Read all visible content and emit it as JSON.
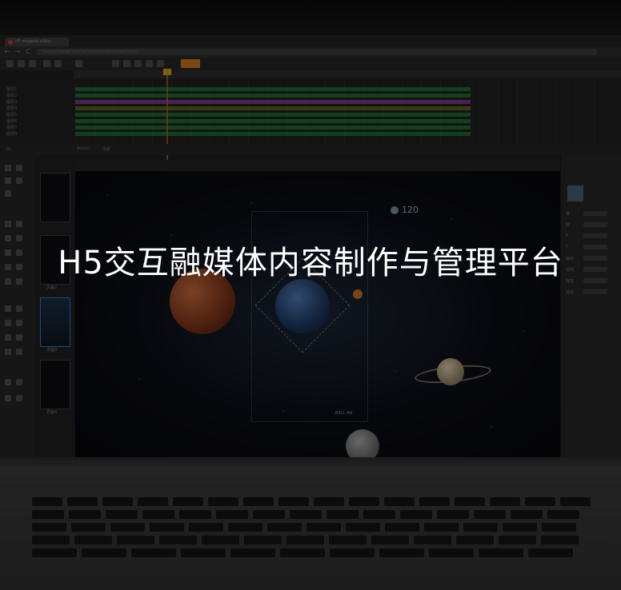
{
  "headline": "H5交互融媒体内容制作与管理平台",
  "browser": {
    "tab_title": "H5 mugeda editor",
    "url": "www.mugeda.com/animation/editor/index.html",
    "back": "←",
    "forward": "→",
    "reload": "C"
  },
  "timeline": {
    "layers": [
      "图层1",
      "图层2",
      "图层3",
      "图层4",
      "图层5",
      "图层6",
      "图层7",
      "图层8"
    ],
    "track_colors": [
      "#1fa33a",
      "#1fa33a",
      "#c04bd0",
      "#7a9a2a",
      "#1fa33a",
      "#1fa33a",
      "#1fa33a",
      "#1fa33a"
    ]
  },
  "panel_bar": {
    "items": [
      "▤",
      "Action",
      "场景"
    ]
  },
  "canvas": {
    "score": "120",
    "caption": "BALL·AN"
  },
  "thumbs": {
    "labels": [
      "",
      "页面2",
      "页面3",
      "页面4"
    ]
  },
  "right_panel": {
    "rows": [
      "宽",
      "高",
      "X",
      "Y",
      "旋转",
      "透明",
      "缩放",
      "填充"
    ]
  },
  "colors": {
    "accent_orange": "#c9751e",
    "selection_blue": "#2b7cc4"
  }
}
